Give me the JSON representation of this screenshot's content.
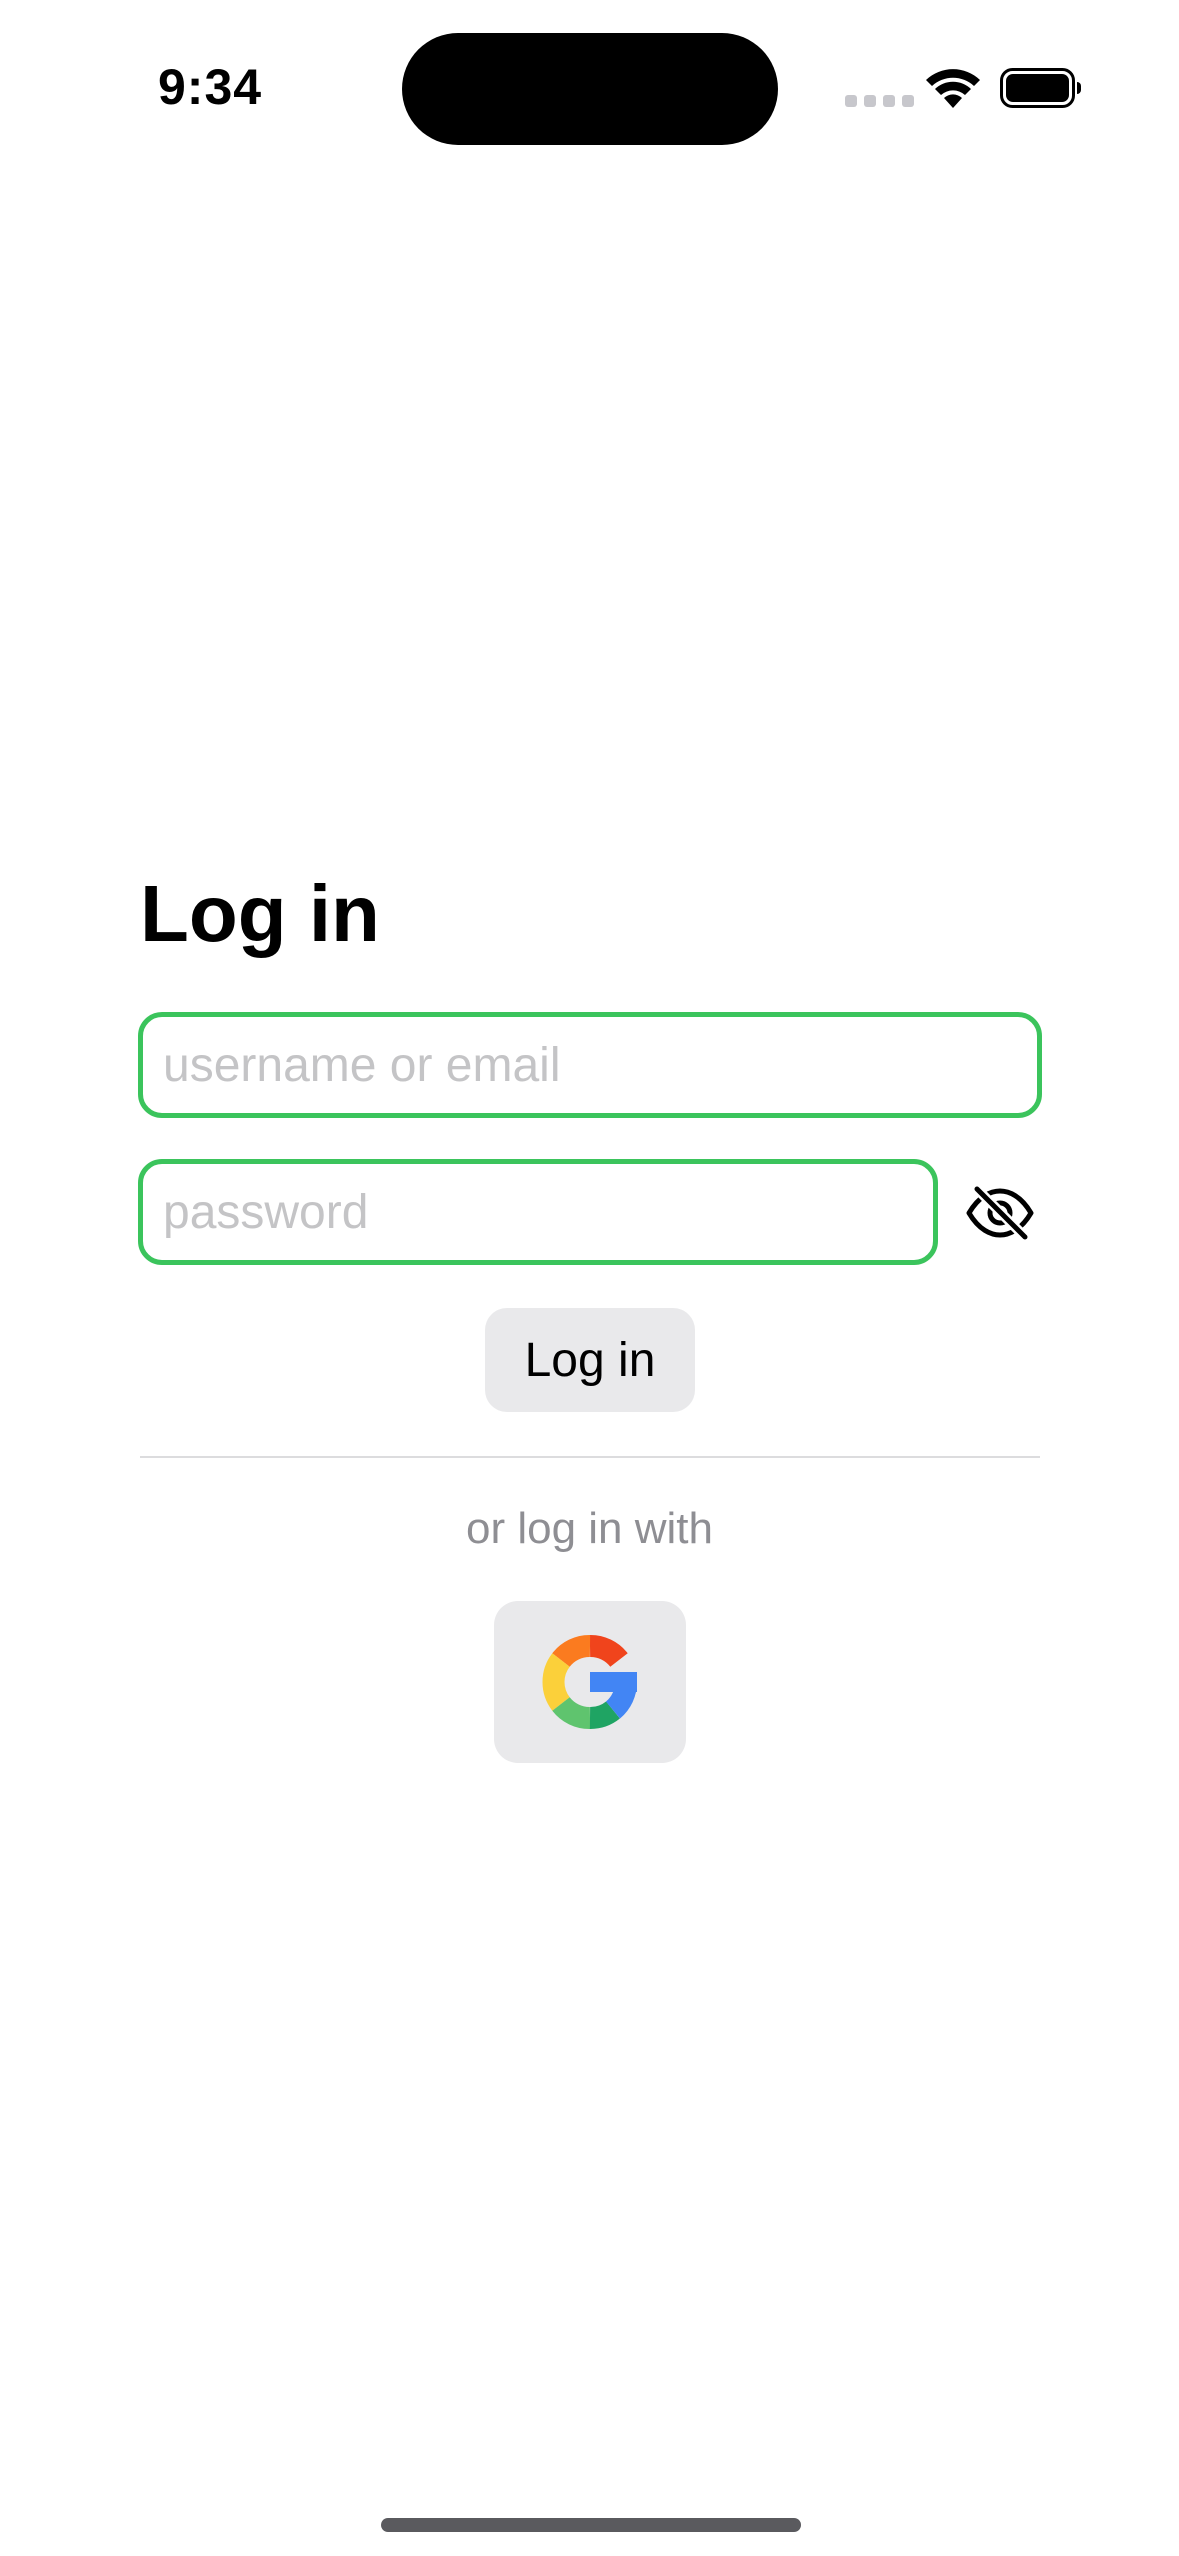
{
  "status_bar": {
    "time": "9:34",
    "icons": [
      "cellular-signal-icon",
      "wifi-icon",
      "battery-icon"
    ]
  },
  "login": {
    "title": "Log in",
    "username": {
      "placeholder": "username or email",
      "value": ""
    },
    "password": {
      "placeholder": "password",
      "value": ""
    },
    "password_toggle_icon": "eye-slash-icon",
    "submit_label": "Log in",
    "alternate_text": "or log in with",
    "providers": [
      {
        "icon": "google-icon"
      }
    ]
  },
  "colors": {
    "field_border": "#3bc45c",
    "button_bg": "#e9e9eb",
    "placeholder": "#c4c4c6",
    "secondary_text": "#8e8e93",
    "divider": "#dcdcde"
  }
}
